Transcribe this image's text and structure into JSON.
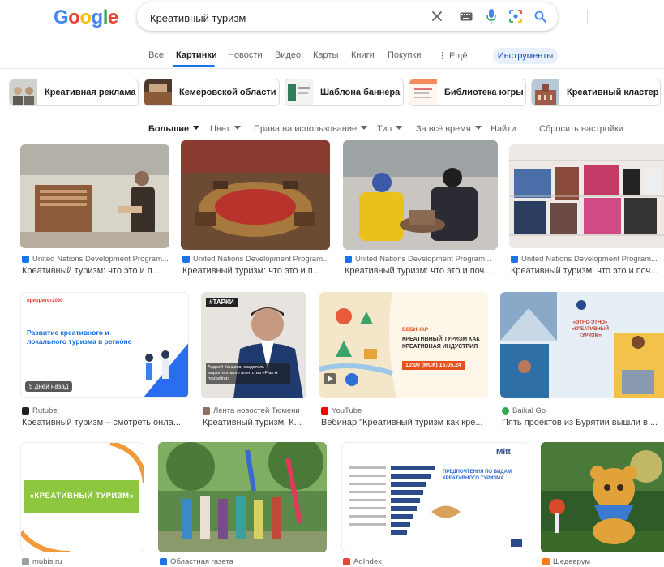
{
  "brand": {
    "logo_letters": [
      "G",
      "o",
      "o",
      "g",
      "l",
      "e"
    ],
    "logo_colors": [
      "#4285F4",
      "#EA4335",
      "#FBBC05",
      "#4285F4",
      "#34A853",
      "#EA4335"
    ]
  },
  "search": {
    "query": "Креативный туризм"
  },
  "tabs": [
    {
      "label": "Все"
    },
    {
      "label": "Картинки"
    },
    {
      "label": "Новости"
    },
    {
      "label": "Видео"
    },
    {
      "label": "Карты"
    },
    {
      "label": "Книги"
    },
    {
      "label": "Покупки"
    },
    {
      "label": "⋮ Ещё"
    }
  ],
  "tools_label": "Инструменты",
  "chips": [
    {
      "label": "Креативная реклама"
    },
    {
      "label": "Кемеровской области"
    },
    {
      "label": "Шаблона баннера"
    },
    {
      "label": "Библиотека югры"
    },
    {
      "label": "Креативный кластер"
    }
  ],
  "filters": [
    {
      "label": "Большие"
    },
    {
      "label": "Цвет"
    },
    {
      "label": "Права на использование"
    },
    {
      "label": "Тип"
    },
    {
      "label": "За всё время"
    },
    {
      "label": "Найти"
    },
    {
      "label": "Сбросить настройки"
    }
  ],
  "results": [
    {
      "source": "United Nations Development Program...",
      "title": "Креативный туризм: что это и п...",
      "favicon_color": "#1a73e8"
    },
    {
      "source": "United Nations Development Program...",
      "title": "Креативный туризм: что это и п...",
      "favicon_color": "#1a73e8"
    },
    {
      "source": "United Nations Development Program...",
      "title": "Креативный туризм: что это и поч...",
      "favicon_color": "#1a73e8"
    },
    {
      "source": "United Nations Development Program...",
      "title": "Креативный туризм: что это и поч...",
      "favicon_color": "#1a73e8"
    },
    {
      "source": "Rutube",
      "title": "Креативный туризм – смотреть онла...",
      "favicon_color": "#202124",
      "badge": "5 дней назад",
      "img_text": {
        "brand": "приоритет2030",
        "headline": "Развитие креативного и локального туризма в регионе"
      }
    },
    {
      "source": "Лента новостей Тюмени",
      "title": "Креативный туризм. К...",
      "favicon_color": "#8d6e63",
      "img_text": {
        "brand": "#ТАРКИ",
        "caption": "Андрей Коньков, создатель маркетингового агентства «Plan A marketing»"
      }
    },
    {
      "source": "YouTube",
      "title": "Вебинар \"Креативный туризм как кре...",
      "favicon_color": "#ff0000",
      "img_text": {
        "tag": "ВЕБИНАР",
        "headline": "КРЕАТИВНЫЙ ТУРИЗМ КАК КРЕАТИВНАЯ ИНДУСТРИЯ",
        "date": "10:00 (МСК) 15.05.24"
      }
    },
    {
      "source": "Baikal Go",
      "title": "Пять проектов из Бурятии вышли в ...",
      "favicon_color": "#34a853",
      "img_text": {
        "headline": "«ЭТНО-ЭТНО» «КРЕАТИВНЫЙ ТУРИЗМ»"
      }
    },
    {
      "source": "mubis.ru",
      "title": "",
      "favicon_color": "#9aa0a6",
      "img_text": {
        "headline": "«КРЕАТИВНЫЙ ТУРИЗМ»"
      }
    },
    {
      "source": "Областная газета",
      "title": "",
      "favicon_color": "#1a73e8"
    },
    {
      "source": "AdIndex",
      "title": "",
      "favicon_color": "#ea4335",
      "img_text": {
        "brand": "Mitt",
        "headline": "ПРЕДПОЧТЕНИЯ ПО ВИДАМ КРЕАТИВНОГО ТУРИЗМА"
      }
    },
    {
      "source": "Шедеврум",
      "title": "",
      "favicon_color": "#fa7b17"
    }
  ]
}
